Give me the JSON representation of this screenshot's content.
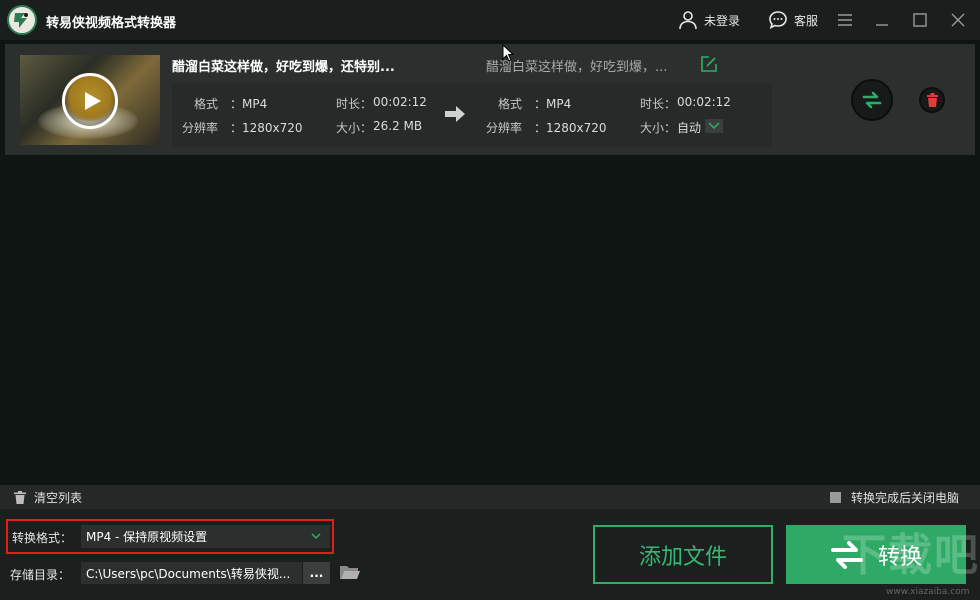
{
  "app": {
    "title": "转易侠视频格式转换器"
  },
  "titlebar": {
    "login_label": "未登录",
    "service_label": "客服"
  },
  "file": {
    "source_name": "醋溜白菜这样做，好吃到爆，还特别...",
    "output_name": "醋溜白菜这样做，好吃到爆，...",
    "source": {
      "format_label": "格式",
      "format_value": "：MP4",
      "resolution_label": "分辨率",
      "resolution_value": "：1280x720",
      "duration_label": "时长：",
      "duration_value": "00:02:12",
      "size_label": "大小：",
      "size_value": "26.2 MB"
    },
    "output": {
      "format_label": "格式",
      "format_value": "：MP4",
      "resolution_label": "分辨率",
      "resolution_value": "：1280x720",
      "duration_label": "时长：",
      "duration_value": "00:02:12",
      "size_label": "大小：",
      "size_value": "自动"
    }
  },
  "bottom": {
    "clear_list_label": "清空列表",
    "shutdown_label": "转换完成后关闭电脑",
    "format_label": "转换格式：",
    "format_value": "MP4 - 保持原视频设置",
    "dir_label": "存储目录：",
    "dir_value": "C:\\Users\\pc\\Documents\\转易侠视...",
    "dir_browse_label": "...",
    "add_file_label": "添加文件",
    "convert_label": "转换"
  },
  "watermark": {
    "text": "下载吧",
    "url": "www.xiazaiba.com"
  },
  "colors": {
    "accent": "#2faa66",
    "highlight_border": "#e01e1e",
    "delete_red": "#e23b3b",
    "background": "#0f1513",
    "panel": "#2b302f"
  }
}
